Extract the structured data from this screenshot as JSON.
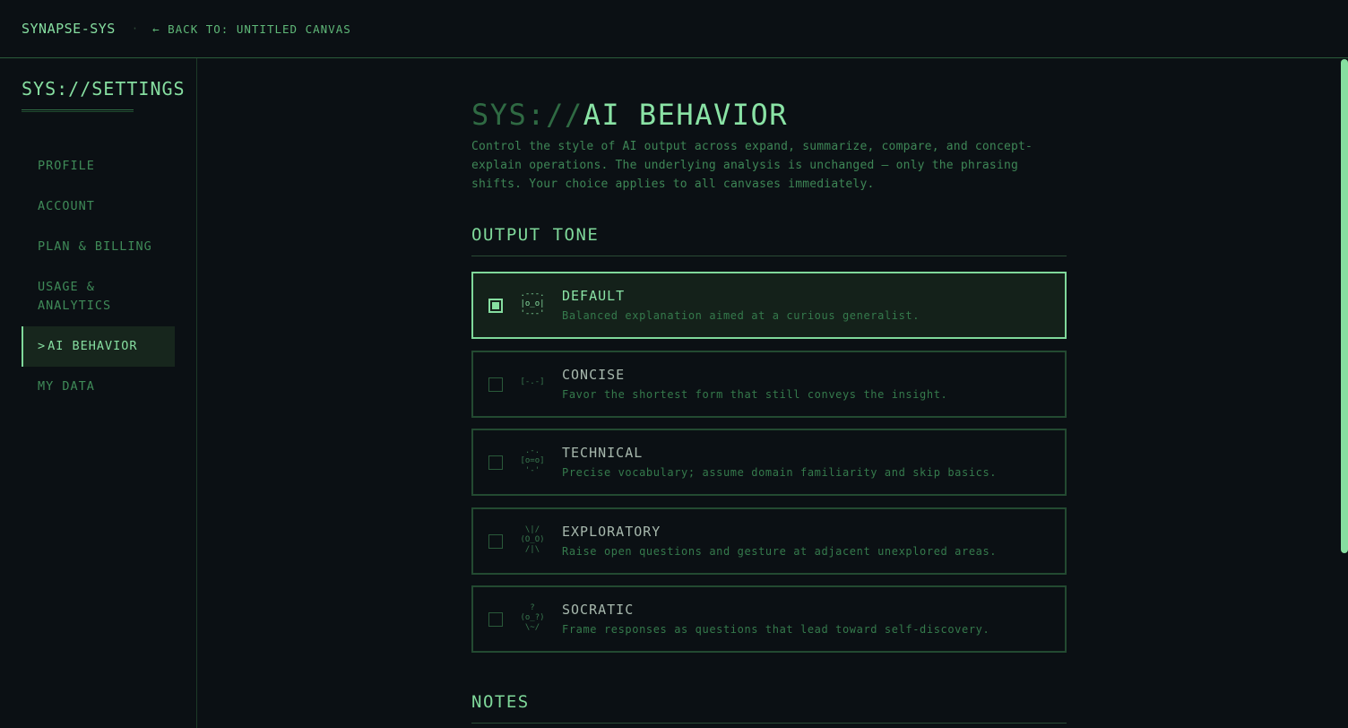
{
  "topbar": {
    "brand": "SYNAPSE-SYS",
    "separator": "·",
    "back_link": "← BACK TO: UNTITLED CANVAS"
  },
  "sidebar": {
    "title": "SYS://SETTINGS",
    "items": [
      {
        "label": "PROFILE",
        "active": false
      },
      {
        "label": "ACCOUNT",
        "active": false
      },
      {
        "label": "PLAN & BILLING",
        "active": false
      },
      {
        "label": "USAGE & ANALYTICS",
        "active": false
      },
      {
        "label": "AI BEHAVIOR",
        "active": true,
        "caret": ">"
      },
      {
        "label": "MY DATA",
        "active": false
      }
    ]
  },
  "page": {
    "heading_prefix": "SYS://",
    "heading_main": "AI BEHAVIOR",
    "description": "Control the style of AI output across expand, summarize, compare, and concept-explain operations. The underlying analysis is unchanged — only the phrasing shifts. Your choice applies to all canvases immediately."
  },
  "output_tone": {
    "title": "OUTPUT TONE",
    "options": [
      {
        "title": "DEFAULT",
        "description": "Balanced explanation aimed at a curious generalist.",
        "glyph": ".---.\n|o_o|\n'---'",
        "selected": true
      },
      {
        "title": "CONCISE",
        "description": "Favor the shortest form that still conveys the insight.",
        "glyph": "[-.-]",
        "selected": false
      },
      {
        "title": "TECHNICAL",
        "description": "Precise vocabulary; assume domain familiarity and skip basics.",
        "glyph": ".-.\n[o=o]\n'-'",
        "selected": false
      },
      {
        "title": "EXPLORATORY",
        "description": "Raise open questions and gesture at adjacent unexplored areas.",
        "glyph": "\\|/\n(O_O)\n/|\\",
        "selected": false
      },
      {
        "title": "SOCRATIC",
        "description": "Frame responses as questions that lead toward self-discovery.",
        "glyph": "?\n(o_?)\n\\~/",
        "selected": false
      }
    ]
  },
  "notes": {
    "title": "NOTES"
  },
  "colors": {
    "background": "#0b1014",
    "accent": "#7fd89a",
    "dim_accent": "#3e8656",
    "border": "#234a31"
  }
}
